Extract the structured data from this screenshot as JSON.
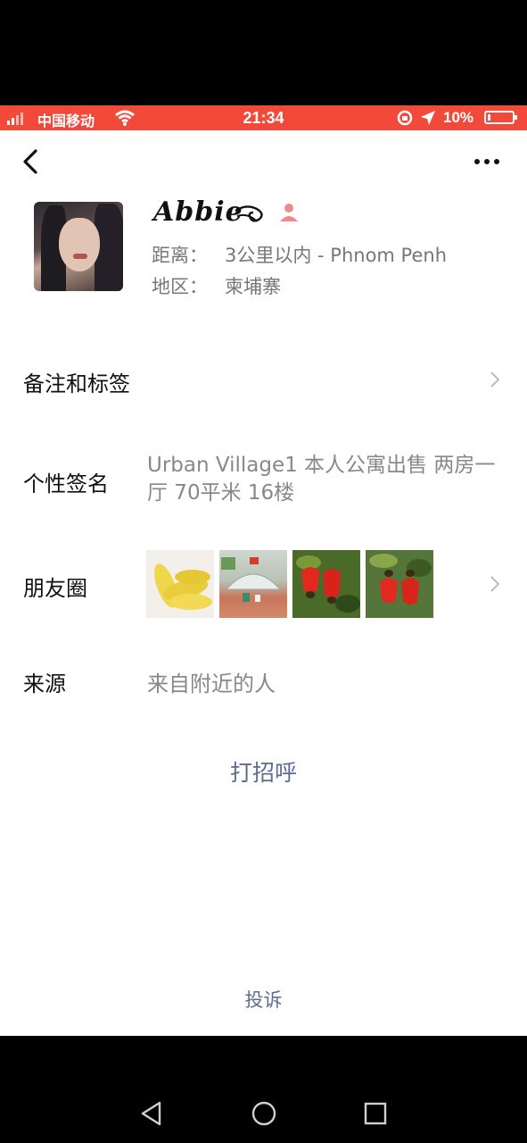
{
  "status_bar": {
    "carrier": "中国移动",
    "time": "21:34",
    "battery": "10%"
  },
  "header": {
    "back_icon": "back-chevron-icon",
    "more_icon": "more-dots-icon"
  },
  "profile": {
    "name": "Abbie",
    "distance_label": "距离：",
    "distance_value": "3公里以内 - Phnom Penh",
    "region_label": "地区：",
    "region_value": "柬埔寨"
  },
  "rows": {
    "remark_label": "备注和标签",
    "signature_label": "个性签名",
    "signature_value": "Urban Village1 本人公寓出售 两房一厅 70平米 16楼",
    "moments_label": "朋友圈",
    "source_label": "来源",
    "source_value": "来自附近的人"
  },
  "actions": {
    "greet": "打招呼",
    "complain": "投诉"
  },
  "colors": {
    "status_bar": "#f24a3a",
    "link": "#5b6b94",
    "gender_female": "#f08a8a"
  }
}
